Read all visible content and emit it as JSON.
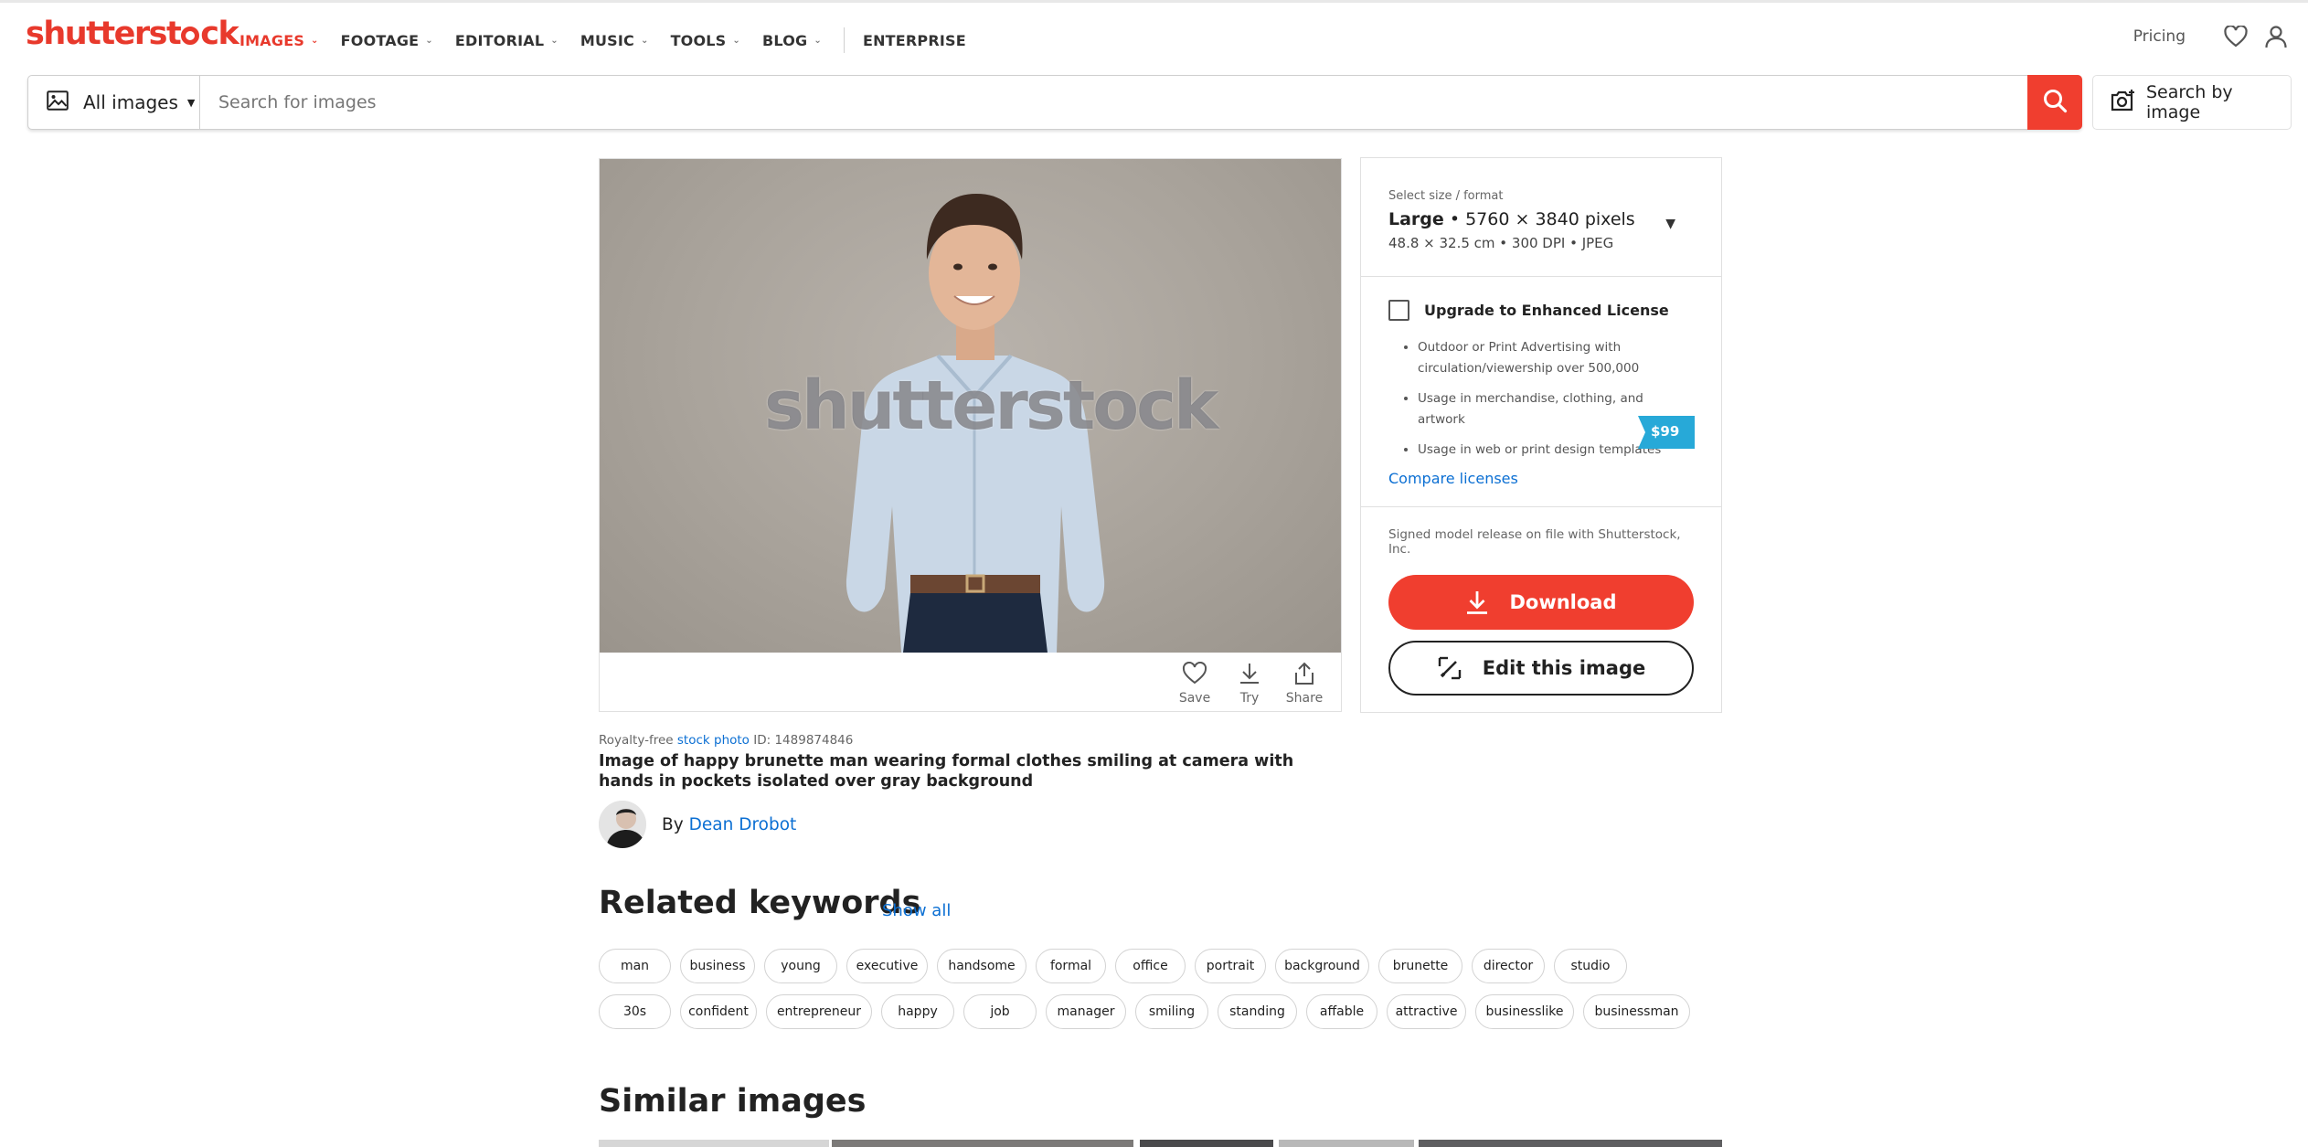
{
  "nav": {
    "logo": "shutterstock",
    "items": [
      {
        "label": "IMAGES",
        "active": true
      },
      {
        "label": "FOOTAGE"
      },
      {
        "label": "EDITORIAL"
      },
      {
        "label": "MUSIC"
      },
      {
        "label": "TOOLS"
      },
      {
        "label": "BLOG"
      }
    ],
    "enterprise": "ENTERPRISE",
    "pricing": "Pricing",
    "icons": [
      "heart-icon",
      "user-icon"
    ]
  },
  "search": {
    "asset_type": "All images",
    "placeholder": "Search for images",
    "search_by_image": "Search by image"
  },
  "image": {
    "watermark": "shutterstock",
    "actions": {
      "save": "Save",
      "try": "Try",
      "share": "Share"
    }
  },
  "license": {
    "size_label": "Select size / format",
    "size_name": "Large",
    "size_pixels": "• 5760 × 3840 pixels",
    "size_detail": "48.8 × 32.5 cm • 300 DPI • JPEG",
    "upgrade_label": "Upgrade to Enhanced License",
    "upgrade_price": "$99",
    "benefits": [
      "Outdoor or Print Advertising with circulation/viewership over 500,000",
      "Usage in merchandise, clothing, and artwork",
      "Usage in web or print design templates"
    ],
    "compare": "Compare licenses",
    "release_note": "Signed model release on file with Shutterstock, Inc.",
    "download": "Download",
    "edit": "Edit this image"
  },
  "details": {
    "royalty_prefix": "Royalty-free",
    "royalty_link": "stock photo",
    "id_text": "ID: 1489874846",
    "title": "Image of happy brunette man wearing formal clothes smiling at camera with hands in pockets isolated over gray background",
    "by": "By",
    "author": "Dean Drobot"
  },
  "related": {
    "heading": "Related keywords",
    "show_all": "Show all",
    "row1": [
      "man",
      "business",
      "young",
      "executive",
      "handsome",
      "formal",
      "office",
      "portrait",
      "background",
      "brunette",
      "director",
      "studio"
    ],
    "row2": [
      "30s",
      "confident",
      "entrepreneur",
      "happy",
      "job",
      "manager",
      "smiling",
      "standing",
      "affable",
      "attractive",
      "businesslike",
      "businessman"
    ]
  },
  "similar": {
    "heading": "Similar images"
  },
  "colors": {
    "brand_red": "#e8392c",
    "button_red": "#f03e2f",
    "link_blue": "#0b6fd3",
    "price_tag": "#27a9d8"
  }
}
